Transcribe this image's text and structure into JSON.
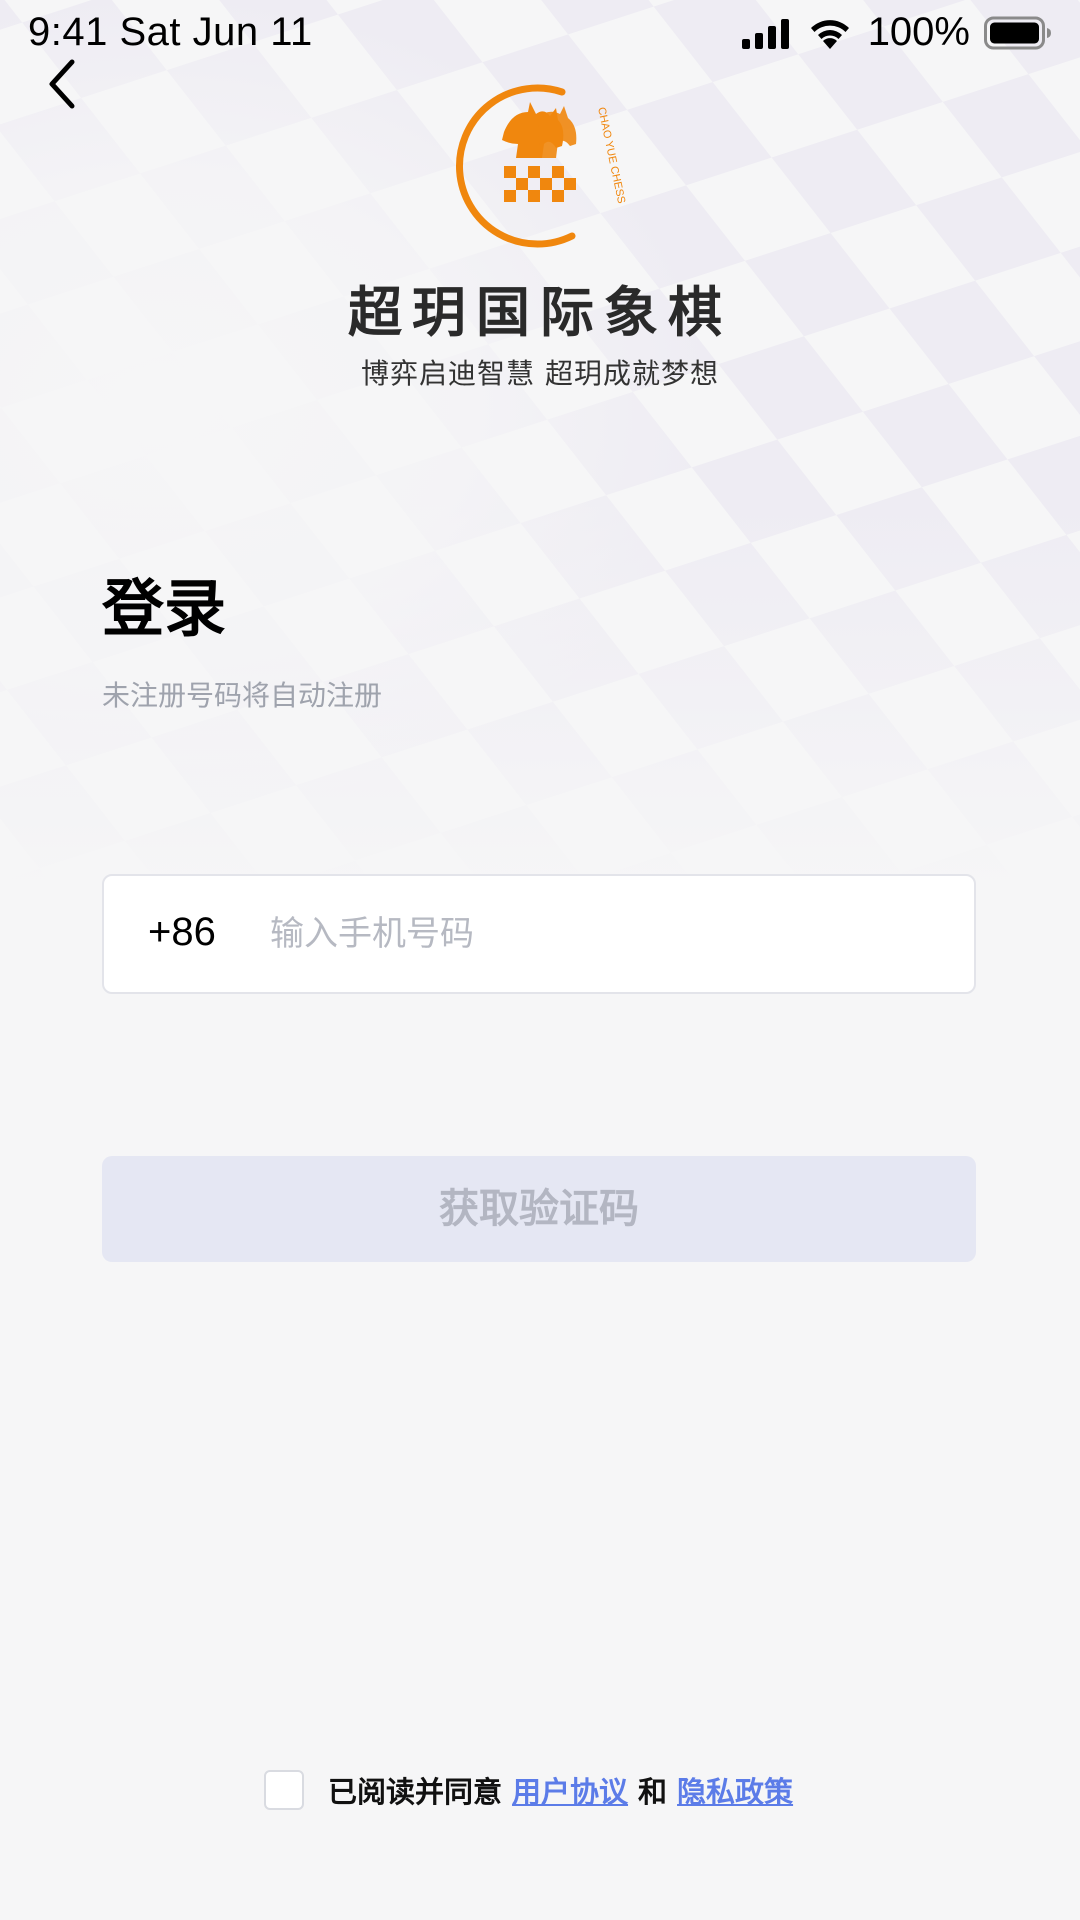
{
  "status_bar": {
    "time": "9:41  Sat Jun 11",
    "battery": "100%"
  },
  "brand": {
    "logo_text": "CHAO YUE CHESS",
    "title": "超玥国际象棋",
    "slogan": "博弈启迪智慧 超玥成就梦想",
    "accent_color": "#f0870e"
  },
  "login": {
    "heading": "登录",
    "hint": "未注册号码将自动注册",
    "country_code": "+86",
    "phone_placeholder": "输入手机号码",
    "phone_value": "",
    "get_code_label": "获取验证码"
  },
  "agreement": {
    "prefix": "已阅读并同意",
    "user_agreement": "用户协议",
    "conjunction": "和",
    "privacy_policy": "隐私政策",
    "checked": false
  },
  "icons": {
    "back": "chevron-left-icon",
    "signal": "cellular-signal-icon",
    "wifi": "wifi-icon",
    "battery": "battery-icon"
  }
}
